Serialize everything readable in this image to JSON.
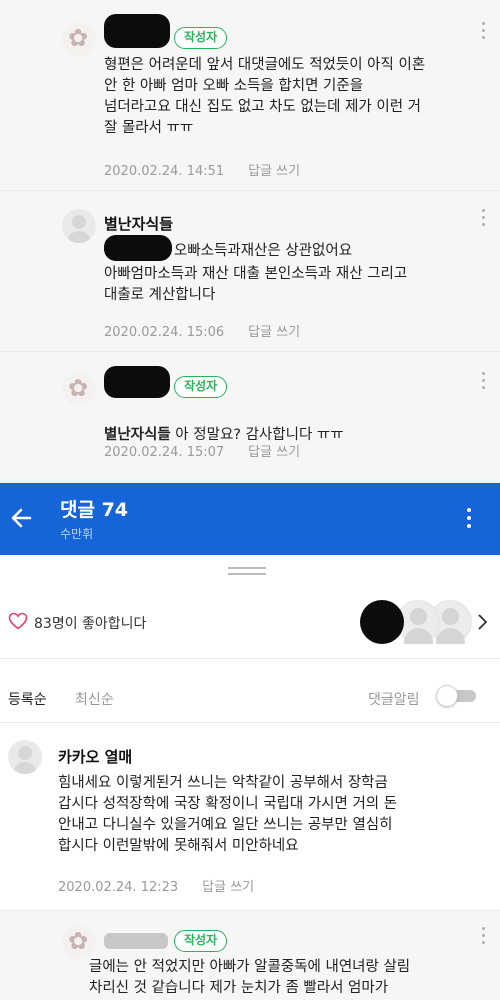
{
  "thread": {
    "comment1": {
      "badge": "작성자",
      "text": "형편은 어려운데 앞서 대댓글에도 적었듯이 아직 이혼\n안 한 아빠 엄마 오빠 소득을 합치면 기준을\n넘더라고요 대신 집도 없고 차도 없는데 제가 이런 거\n잘 몰라서 ㅠㅠ",
      "date": "2020.02.24. 14:51",
      "reply_label": "답글 쓰기"
    },
    "comment2": {
      "author": "별난자식들",
      "text_line1": "오빠소득과재산은 상관없어요",
      "text_rest": "아빠엄마소득과 재산 대출 본인소득과 재산 그리고\n대출로 계산합니다",
      "date": "2020.02.24. 15:06",
      "reply_label": "답글 쓰기"
    },
    "comment3": {
      "badge": "작성자",
      "mention": "별난자식들",
      "text": " 아 정말요? 감사합니다 ㅠㅠ",
      "date": "2020.02.24. 15:07",
      "reply_label": "답글 쓰기"
    }
  },
  "header": {
    "title": "댓글 74",
    "subtitle": "수만휘",
    "bg_color": "#1565d8"
  },
  "likes": {
    "text": "83명이 좋아합니다"
  },
  "sort": {
    "registered": "등록순",
    "latest": "최신순",
    "notify_label": "댓글알림",
    "notify_on": false
  },
  "comment4": {
    "author": "카카오 열매",
    "text": "힘내세요 이렇게된거 쓰니는 악착같이 공부해서 장학금\n갑시다 성적장학에 국장 확정이니 국립대 가시면 거의 돈\n안내고 다니실수 있을거예요 일단 쓰니는 공부만 열심히\n합시다 이런말밖에 못해줘서 미안하네요",
    "date": "2020.02.24. 12:23",
    "reply_label": "답글 쓰기"
  },
  "comment5": {
    "badge": "작성자",
    "text": "글에는 안 적었지만 아빠가 알콜중독에 내연녀랑 살림\n차리신 것 같습니다 제가 눈치가 좀 빨라서 엄마가"
  },
  "colors": {
    "accent_green": "#2ab35b",
    "meta_grey": "#9a9a9a"
  }
}
